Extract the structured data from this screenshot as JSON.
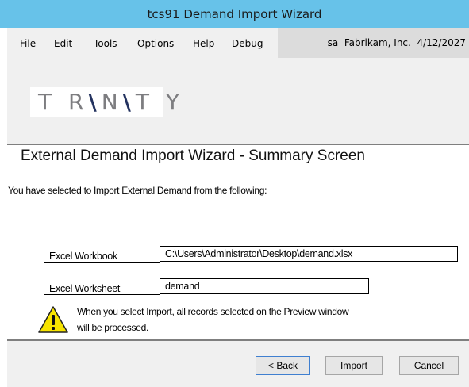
{
  "window": {
    "title": "tcs91 Demand Import Wizard"
  },
  "menu": {
    "items": [
      "File",
      "Edit",
      "Tools",
      "Options",
      "Help",
      "Debug"
    ],
    "status": "sa  Fabrikam, Inc.  4/12/2027"
  },
  "logo": {
    "text": "TRINITY"
  },
  "summary": {
    "title": "External Demand Import Wizard - Summary Screen",
    "intro": "You have selected to Import External Demand from the following:"
  },
  "fields": {
    "workbook_label": "Excel Workbook",
    "workbook_value": "C:\\Users\\Administrator\\Desktop\\demand.xlsx",
    "worksheet_label": "Excel Worksheet",
    "worksheet_value": "demand"
  },
  "warning": {
    "line1": "When you select Import, all records selected on the Preview window",
    "line2": "will be processed.",
    "icon": "warning-icon"
  },
  "buttons": {
    "back_label": "< Back",
    "import_label": "Import",
    "cancel_label": "Cancel"
  },
  "colors": {
    "titlebar": "#67c2e9",
    "panel": "#f0f0f0",
    "warning_yellow": "#f7e400"
  }
}
